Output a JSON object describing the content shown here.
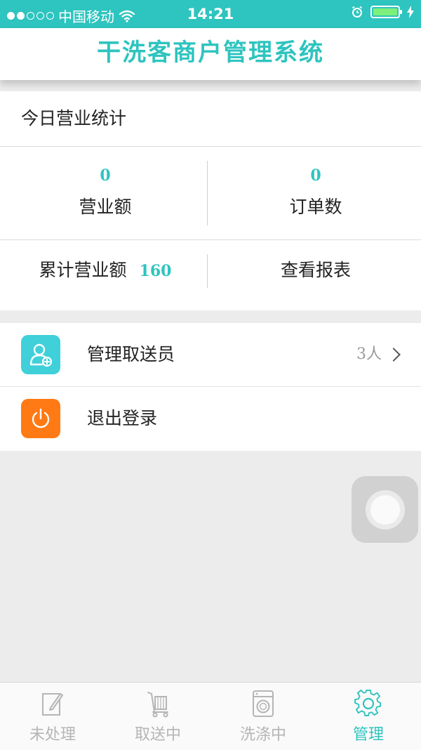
{
  "status_bar": {
    "carrier": "中国移动",
    "time": "14:21"
  },
  "header": {
    "title": "干洗客商户管理系统"
  },
  "stats": {
    "heading": "今日营业统计",
    "revenue_value": "0",
    "revenue_label": "营业额",
    "orders_value": "0",
    "orders_label": "订单数",
    "total_label": "累计营业额",
    "total_value": "160",
    "report_label": "查看报表"
  },
  "menu": {
    "items": [
      {
        "label": "管理取送员",
        "count": "3人"
      },
      {
        "label": "退出登录"
      }
    ]
  },
  "tabs": [
    {
      "label": "未处理",
      "icon": "edit-icon"
    },
    {
      "label": "取送中",
      "icon": "cart-icon"
    },
    {
      "label": "洗涤中",
      "icon": "washing-machine-icon"
    },
    {
      "label": "管理",
      "icon": "gear-icon"
    }
  ],
  "colors": {
    "accent": "#2ec4bf",
    "teal_icon": "#3fd0da",
    "orange_icon": "#ff7a14"
  }
}
